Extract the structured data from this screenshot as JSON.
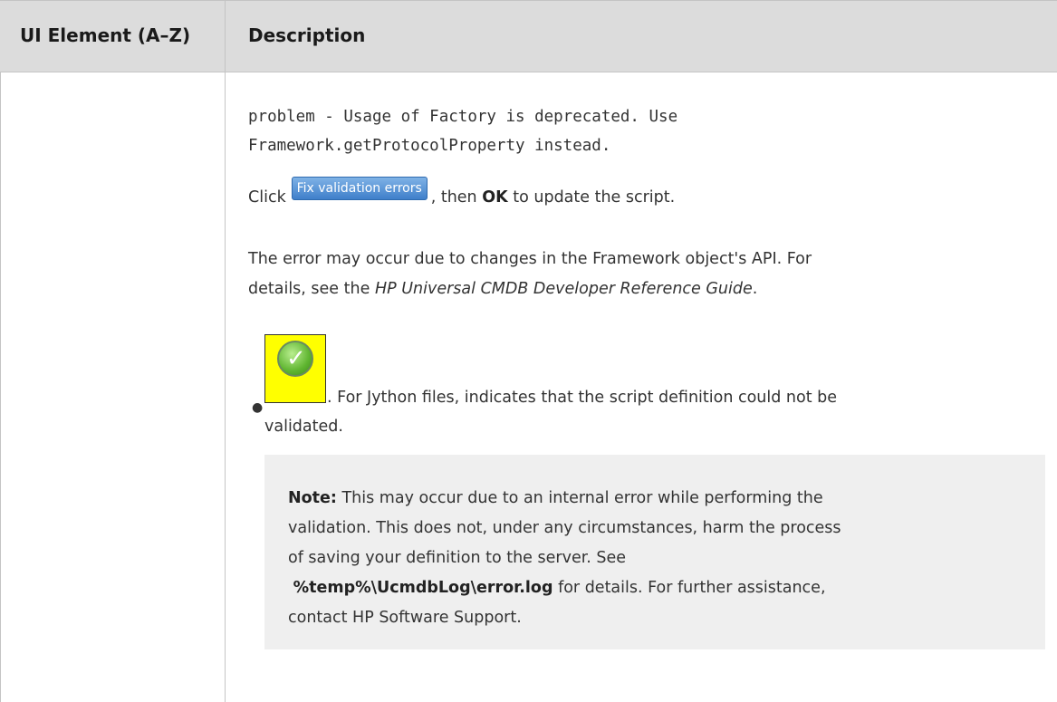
{
  "table": {
    "headers": [
      "UI Element (A–Z)",
      "Description"
    ]
  },
  "description": {
    "code_line1": "problem - Usage of Factory is deprecated. Use",
    "code_line2": "Framework.getProtocolProperty instead.",
    "click_prefix": "Click",
    "fix_button_label": "Fix validation errors",
    "click_mid": ", then",
    "ok_label": "OK",
    "click_suffix": "to update the script.",
    "error_line1": "The error may occur due to changes in the Framework object's API. For",
    "error_line2_prefix": "details, see the",
    "guide_title": "HP Universal CMDB Developer Reference Guide",
    "error_line2_suffix": ".",
    "bullet_suffix1": ". For Jython files, indicates that the script definition could not be",
    "bullet_suffix2": "validated.",
    "status_icon": "green-check-icon",
    "note": {
      "label": "Note:",
      "line1": "This may occur due to an internal error while performing the",
      "line2": "validation. This does not, under any circumstances, harm the process",
      "line3": "of saving your definition to the server. See",
      "log_path": "%temp%\\UcmdbLog\\error.log",
      "line4_suffix": "for details. For further assistance,",
      "line5": "contact HP Software Support."
    }
  }
}
